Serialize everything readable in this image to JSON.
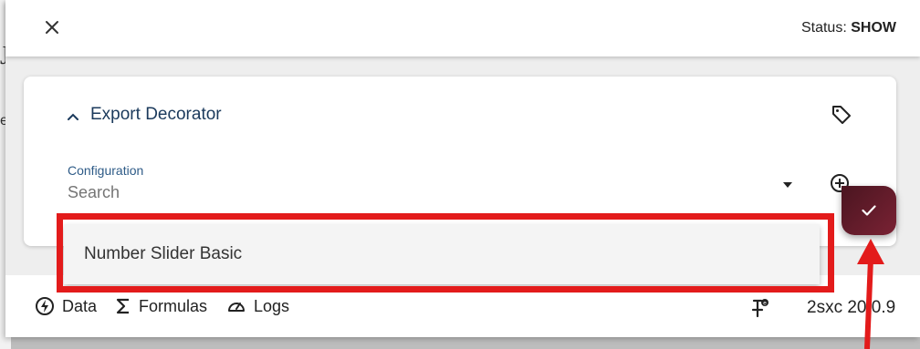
{
  "header": {
    "close_icon": "close-icon",
    "status_label": "Status:",
    "status_value": "SHOW"
  },
  "card": {
    "title": "Export Decorator",
    "config_label": "Configuration",
    "search_placeholder": "Search"
  },
  "suggestion": {
    "label": "Number Slider Basic"
  },
  "footer": {
    "data_label": "Data",
    "formulas_label": "Formulas",
    "logs_label": "Logs",
    "version": "2sxc 20.0.9"
  },
  "colors": {
    "highlight": "#e31b1b",
    "fab": "#6b1d2c",
    "title_blue": "#1b3a5c"
  }
}
